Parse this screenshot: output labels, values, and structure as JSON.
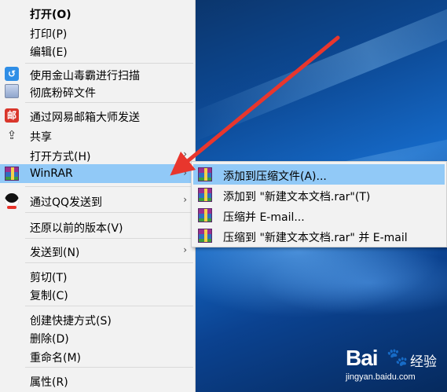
{
  "context_menu": {
    "items": [
      {
        "label": "打开(O)",
        "bold": true
      },
      {
        "label": "打印(P)"
      },
      {
        "label": "编辑(E)"
      },
      {
        "label": "使用金山毒霸进行扫描",
        "icon": "kingsoft-antivirus-icon"
      },
      {
        "label": "彻底粉碎文件",
        "icon": "file-shredder-icon"
      },
      {
        "label": "通过网易邮箱大师发送",
        "icon": "netease-mail-icon",
        "icon_text": "邮"
      },
      {
        "label": "共享",
        "icon": "share-icon"
      },
      {
        "label": "打开方式(H)",
        "submenu": true
      },
      {
        "label": "WinRAR",
        "icon": "winrar-icon",
        "submenu": true,
        "selected": true
      },
      {
        "label": "通过QQ发送到",
        "icon": "qq-icon",
        "submenu": true
      },
      {
        "label": "还原以前的版本(V)"
      },
      {
        "label": "发送到(N)",
        "submenu": true
      },
      {
        "label": "剪切(T)"
      },
      {
        "label": "复制(C)"
      },
      {
        "label": "创建快捷方式(S)"
      },
      {
        "label": "删除(D)"
      },
      {
        "label": "重命名(M)"
      },
      {
        "label": "属性(R)"
      }
    ]
  },
  "winrar_submenu": {
    "items": [
      {
        "label": "添加到压缩文件(A)...",
        "selected": true
      },
      {
        "label": "添加到 \"新建文本文档.rar\"(T)"
      },
      {
        "label": "压缩并 E-mail..."
      },
      {
        "label": "压缩到 \"新建文本文档.rar\" 并 E-mail"
      }
    ]
  },
  "watermark": {
    "brand": "Bai",
    "suffix": "经验",
    "url": "jingyan.baidu.com"
  },
  "colors": {
    "menu_bg": "#f2f2f2",
    "highlight": "#91c9f7",
    "annotation_arrow": "#e8362d"
  }
}
